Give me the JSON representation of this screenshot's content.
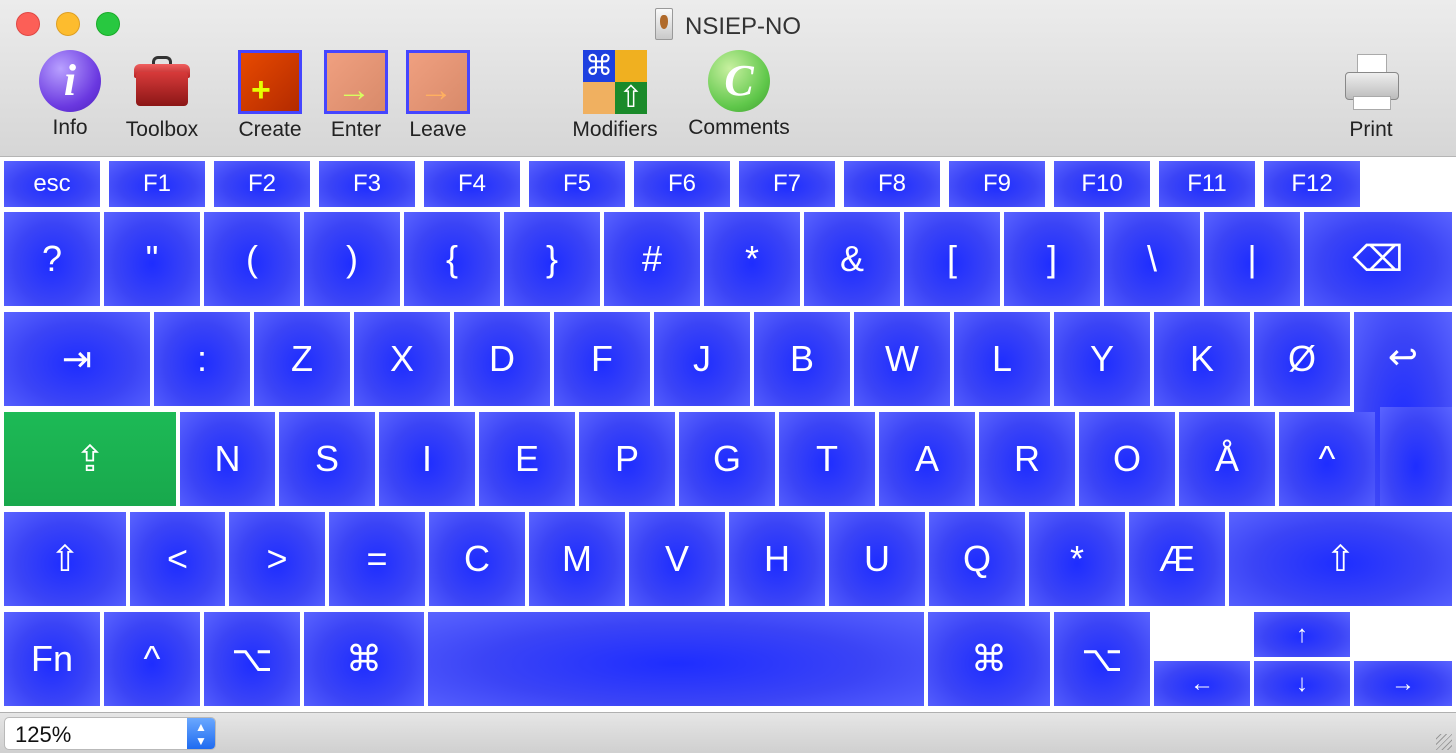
{
  "window": {
    "title": "NSIEP-NO"
  },
  "toolbar": {
    "info": "Info",
    "toolbox": "Toolbox",
    "create": "Create",
    "enter": "Enter",
    "leave": "Leave",
    "modifiers": "Modifiers",
    "comments": "Comments",
    "print": "Print"
  },
  "keyboard": {
    "fn_row": [
      "esc",
      "F1",
      "F2",
      "F3",
      "F4",
      "F5",
      "F6",
      "F7",
      "F8",
      "F9",
      "F10",
      "F11",
      "F12"
    ],
    "row1": [
      "?",
      "\"",
      "(",
      ")",
      "{",
      "}",
      "#",
      "*",
      "&",
      "[",
      "]",
      "\\",
      "|",
      "⌫"
    ],
    "row2": [
      "⇥",
      ":",
      "Z",
      "X",
      "D",
      "F",
      "J",
      "B",
      "W",
      "L",
      "Y",
      "K",
      "Ø",
      "↩"
    ],
    "row3": [
      "⇪",
      "N",
      "S",
      "I",
      "E",
      "P",
      "G",
      "T",
      "A",
      "R",
      "O",
      "Å",
      "^"
    ],
    "row4": [
      "⇧",
      "<",
      ">",
      "=",
      "C",
      "M",
      "V",
      "H",
      "U",
      "Q",
      "*",
      "Æ",
      "⇧"
    ],
    "row5": [
      "Fn",
      "^",
      "⌥",
      "⌘",
      "",
      "⌘",
      "⌥"
    ],
    "arrows": {
      "up": "↑",
      "left": "←",
      "down": "↓",
      "right": "→"
    },
    "colors": {
      "key": "#2a35ff",
      "caps_lock": "#18a84c"
    }
  },
  "status": {
    "zoom": "125%"
  }
}
